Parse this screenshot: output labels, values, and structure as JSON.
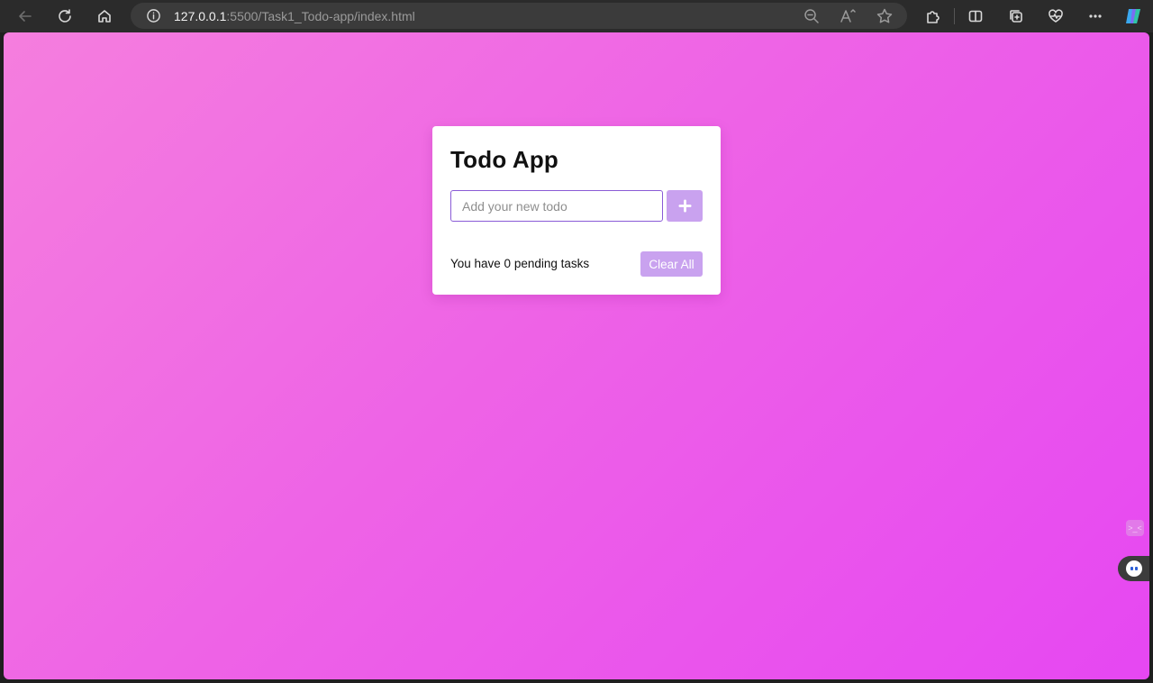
{
  "browser": {
    "url_host": "127.0.0.1",
    "url_rest": ":5500/Task1_Todo-app/index.html"
  },
  "app": {
    "title": "Todo App",
    "input": {
      "placeholder": "Add your new todo",
      "value": ""
    },
    "add_button_icon": "plus-icon",
    "pending_text": "You have 0 pending tasks",
    "clear_button_label": "Clear All"
  },
  "colors": {
    "accent": "#c9a2ef",
    "input_border": "#8a5bd6",
    "background_start": "#f57ede",
    "background_end": "#e647f2"
  }
}
